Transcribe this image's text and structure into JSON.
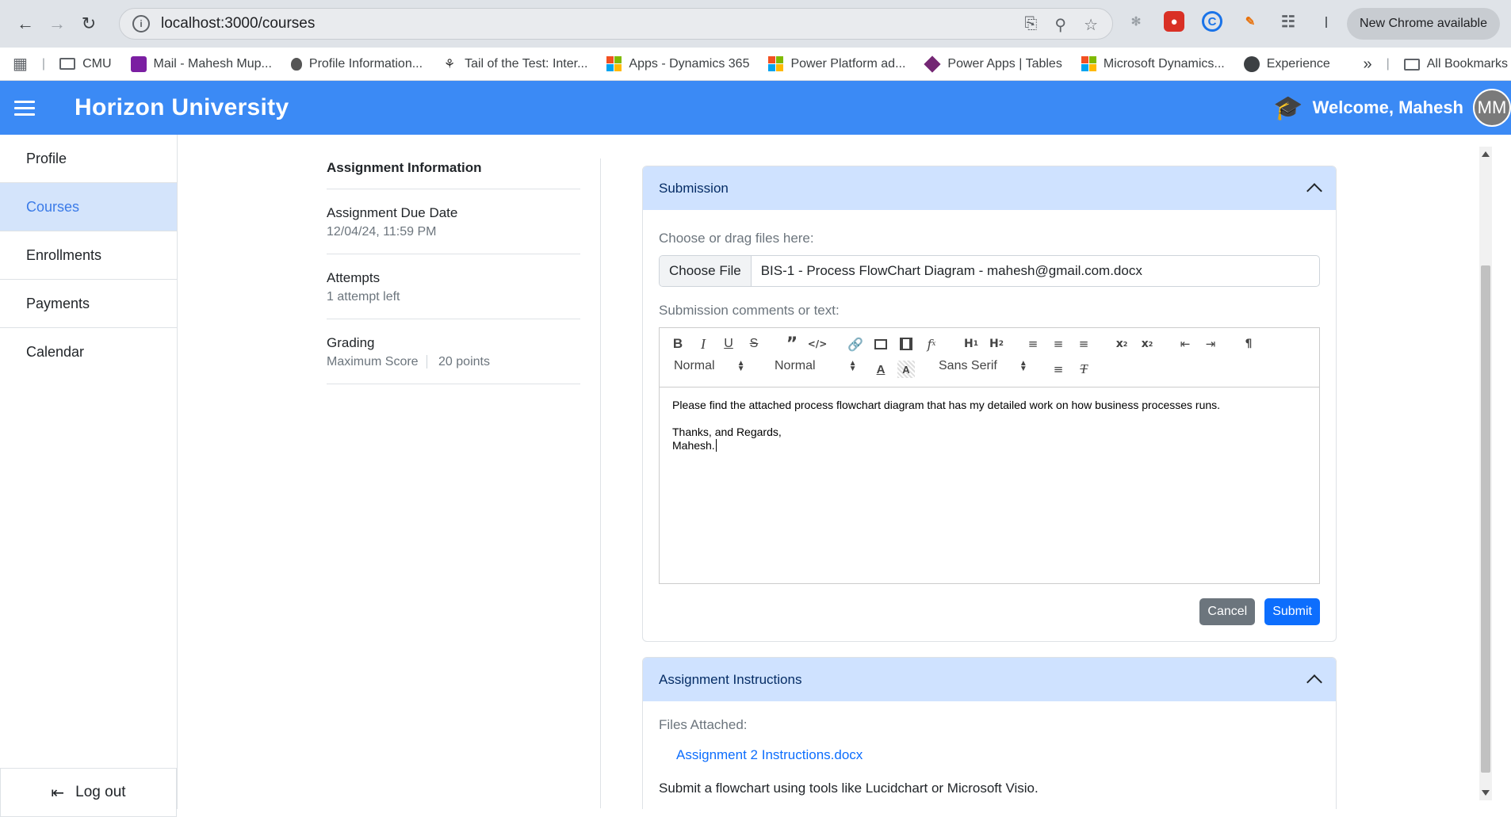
{
  "browser": {
    "url": "localhost:3000/courses",
    "new_chrome": "New Chrome available",
    "bookmarks": [
      {
        "label": "CMU",
        "icon": "folder-icon"
      },
      {
        "label": "Mail - Mahesh Mup...",
        "icon": "mail-icon"
      },
      {
        "label": "Profile Information...",
        "icon": "apple-icon"
      },
      {
        "label": "Tail of the Test: Inter...",
        "icon": "site-icon"
      },
      {
        "label": "Apps - Dynamics 365",
        "icon": "microsoft-icon"
      },
      {
        "label": "Power Platform ad...",
        "icon": "microsoft-icon"
      },
      {
        "label": "Power Apps | Tables",
        "icon": "powerapps-icon"
      },
      {
        "label": "Microsoft Dynamics...",
        "icon": "microsoft-icon"
      },
      {
        "label": "Experience",
        "icon": "globe-icon"
      }
    ],
    "all_bookmarks": "All Bookmarks"
  },
  "header": {
    "brand": "Horizon University",
    "welcome": "Welcome, Mahesh",
    "avatar": "MM"
  },
  "sidebar": {
    "items": [
      {
        "label": "Profile"
      },
      {
        "label": "Courses"
      },
      {
        "label": "Enrollments"
      },
      {
        "label": "Payments"
      },
      {
        "label": "Calendar"
      }
    ],
    "logout": "Log out"
  },
  "assignment_info": {
    "heading": "Assignment Information",
    "due_label": "Assignment Due Date",
    "due_value": "12/04/24, 11:59 PM",
    "attempts_label": "Attempts",
    "attempts_value": "1 attempt left",
    "grading_label": "Grading",
    "max_score_label": "Maximum Score",
    "max_score_value": "20 points"
  },
  "submission": {
    "title": "Submission",
    "files_label": "Choose or drag files here:",
    "choose_file": "Choose File",
    "file_name": "BIS-1 - Process FlowChart Diagram - mahesh@gmail.com.docx",
    "comments_label": "Submission comments or text:",
    "toolbar": {
      "header_select": "Normal",
      "size_select": "Normal",
      "font_select": "Sans Serif"
    },
    "editor_lines": [
      "Please find the attached process flowchart diagram that has my detailed work on how business processes runs.",
      "",
      "Thanks, and Regards,",
      "Mahesh."
    ],
    "cancel": "Cancel",
    "submit": "Submit"
  },
  "instructions": {
    "title": "Assignment Instructions",
    "files_label": "Files Attached:",
    "file_link": "Assignment 2 Instructions.docx",
    "text": "Submit a flowchart using tools like Lucidchart or Microsoft Visio."
  },
  "colors": {
    "header_bg": "#3b8af5",
    "active_nav": "#d4e4fb",
    "card_header": "#cfe2ff",
    "primary": "#0d6efd",
    "secondary": "#6c757d"
  }
}
